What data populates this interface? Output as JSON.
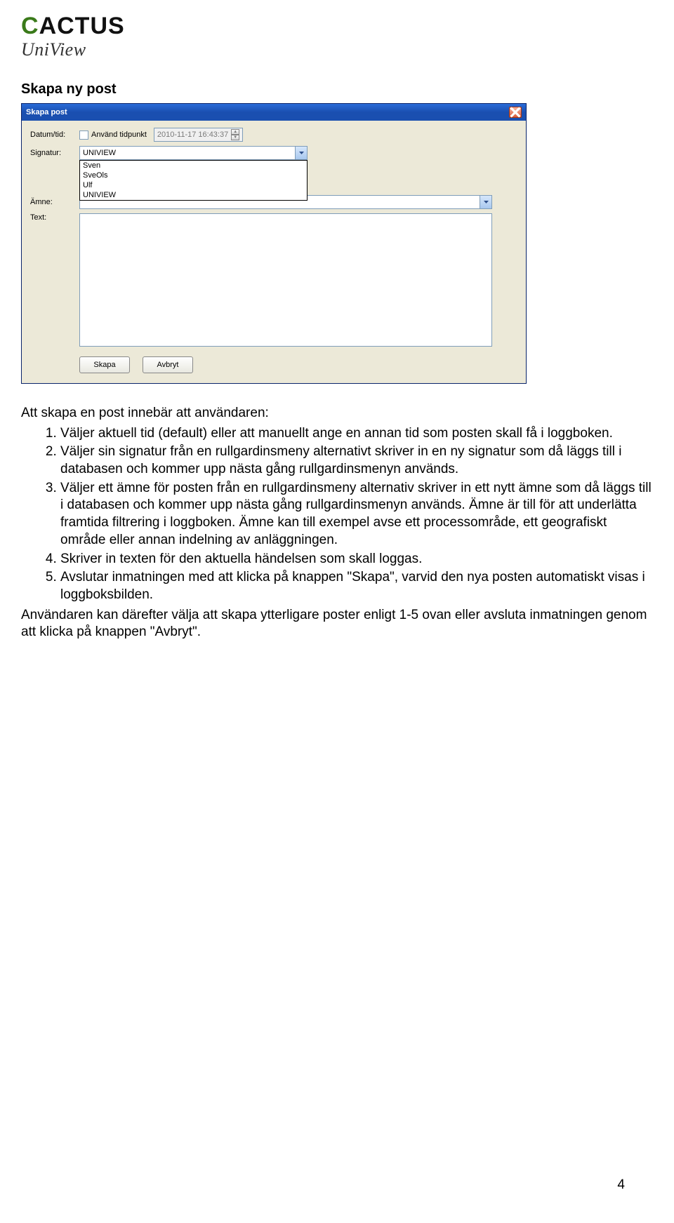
{
  "logo": {
    "top": "CACTUS",
    "bottom": "UniView"
  },
  "section_heading": "Skapa ny post",
  "dialog": {
    "title": "Skapa post",
    "labels": {
      "datumtid": "Datum/tid:",
      "anvand": "Använd tidpunkt",
      "signatur": "Signatur:",
      "amne": "Ämne:",
      "text": "Text:"
    },
    "datetime_value": "2010-11-17 16:43:37",
    "signatur_selected": "UNIVIEW",
    "signatur_options": [
      "Sven",
      "SveOls",
      "Ulf",
      "UNIVIEW"
    ],
    "buttons": {
      "skapa": "Skapa",
      "avbryt": "Avbryt"
    }
  },
  "body": {
    "intro": "Att skapa en post innebär att användaren:",
    "items": [
      "Väljer aktuell tid (default) eller att manuellt ange en annan tid som posten skall få i loggboken.",
      "Väljer sin signatur från en rullgardinsmeny alternativt skriver in en ny signatur som då läggs till i databasen och kommer upp nästa gång rullgardinsmenyn används.",
      "Väljer ett ämne för posten från en rullgardinsmeny alternativ skriver in ett nytt ämne som då läggs till i databasen och kommer upp nästa gång rullgardinsmenyn används. Ämne är till för att underlätta framtida filtrering i loggboken. Ämne kan till exempel avse ett processområde, ett geografiskt område eller annan indelning av anläggningen.",
      "Skriver in texten för den aktuella händelsen som skall loggas.",
      "Avslutar inmatningen med att klicka på knappen \"Skapa\", varvid den nya posten automatiskt visas i loggboksbilden."
    ],
    "outro": "Användaren kan därefter välja att skapa ytterligare poster enligt 1-5 ovan eller avsluta inmatningen genom att klicka på knappen \"Avbryt\"."
  },
  "page_number": "4"
}
